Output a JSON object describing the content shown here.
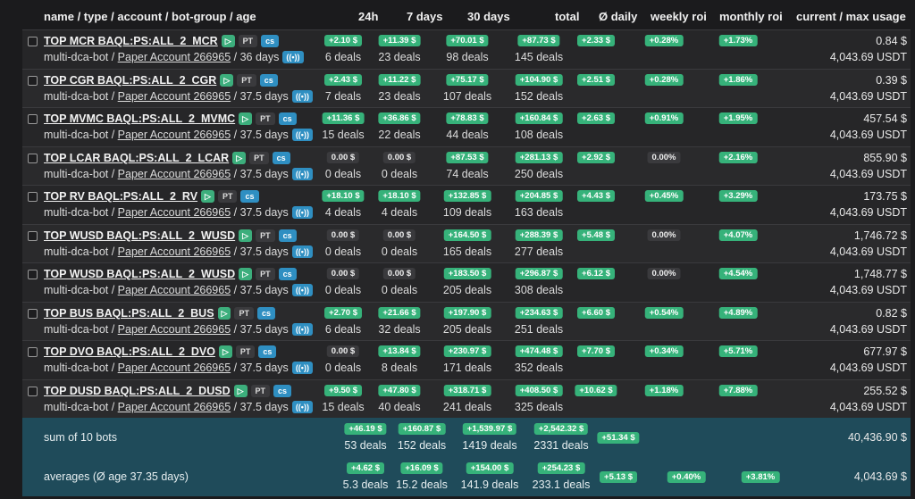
{
  "header": {
    "name_col": "name / type / account / bot-group / age",
    "h24": "24h",
    "d7": "7 days",
    "d30": "30 days",
    "total": "total",
    "daily": "Ø daily",
    "weekly": "weekly roi",
    "monthly": "monthly roi",
    "usage": "current / max usage"
  },
  "tags": {
    "play": "▷",
    "pt": "PT",
    "cs": "cs",
    "wave": "((•))"
  },
  "colors": {
    "green": "#36b27a",
    "neutral": "#3a3a3d",
    "summary_bg": "#1f4b5a",
    "cs": "#2f8fc2"
  },
  "bots": [
    {
      "name": "TOP MCR BAQL:PS:ALL_2_MCR",
      "type": "multi-dca-bot",
      "account": "Paper Account 266965",
      "age": "36 days",
      "h24": "+2.10 $",
      "h24_deals": "6 deals",
      "d7": "+11.39 $",
      "d7_deals": "23 deals",
      "d30": "+70.01 $",
      "d30_deals": "98 deals",
      "total": "+87.73 $",
      "total_deals": "145 deals",
      "daily": "+2.33 $",
      "weekly": "+0.28%",
      "monthly": "+1.73%",
      "current": "0.84 $",
      "max": "4,043.69 USDT"
    },
    {
      "name": "TOP CGR BAQL:PS:ALL_2_CGR",
      "type": "multi-dca-bot",
      "account": "Paper Account 266965",
      "age": "37.5 days",
      "h24": "+2.43 $",
      "h24_deals": "7 deals",
      "d7": "+11.22 $",
      "d7_deals": "23 deals",
      "d30": "+75.17 $",
      "d30_deals": "107 deals",
      "total": "+104.90 $",
      "total_deals": "152 deals",
      "daily": "+2.51 $",
      "weekly": "+0.28%",
      "monthly": "+1.86%",
      "current": "0.39 $",
      "max": "4,043.69 USDT"
    },
    {
      "name": "TOP MVMC BAQL:PS:ALL_2_MVMC",
      "type": "multi-dca-bot",
      "account": "Paper Account 266965",
      "age": "37.5 days",
      "h24": "+11.36 $",
      "h24_deals": "15 deals",
      "d7": "+36.86 $",
      "d7_deals": "22 deals",
      "d30": "+78.83 $",
      "d30_deals": "44 deals",
      "total": "+160.84 $",
      "total_deals": "108 deals",
      "daily": "+2.63 $",
      "weekly": "+0.91%",
      "monthly": "+1.95%",
      "current": "457.54 $",
      "max": "4,043.69 USDT"
    },
    {
      "name": "TOP LCAR BAQL:PS:ALL_2_LCAR",
      "type": "multi-dca-bot",
      "account": "Paper Account 266965",
      "age": "37.5 days",
      "h24": "0.00 $",
      "h24_deals": "0 deals",
      "d7": "0.00 $",
      "d7_deals": "0 deals",
      "d30": "+87.53 $",
      "d30_deals": "74 deals",
      "total": "+281.13 $",
      "total_deals": "250 deals",
      "daily": "+2.92 $",
      "weekly": "0.00%",
      "monthly": "+2.16%",
      "current": "855.90 $",
      "max": "4,043.69 USDT"
    },
    {
      "name": "TOP RV BAQL:PS:ALL_2_RV",
      "type": "multi-dca-bot",
      "account": "Paper Account 266965",
      "age": "37.5 days",
      "h24": "+18.10 $",
      "h24_deals": "4 deals",
      "d7": "+18.10 $",
      "d7_deals": "4 deals",
      "d30": "+132.85 $",
      "d30_deals": "109 deals",
      "total": "+204.85 $",
      "total_deals": "163 deals",
      "daily": "+4.43 $",
      "weekly": "+0.45%",
      "monthly": "+3.29%",
      "current": "173.75 $",
      "max": "4,043.69 USDT"
    },
    {
      "name": "TOP WUSD BAQL:PS:ALL_2_WUSD",
      "type": "multi-dca-bot",
      "account": "Paper Account 266965",
      "age": "37.5 days",
      "h24": "0.00 $",
      "h24_deals": "0 deals",
      "d7": "0.00 $",
      "d7_deals": "0 deals",
      "d30": "+164.50 $",
      "d30_deals": "165 deals",
      "total": "+288.39 $",
      "total_deals": "277 deals",
      "daily": "+5.48 $",
      "weekly": "0.00%",
      "monthly": "+4.07%",
      "current": "1,746.72 $",
      "max": "4,043.69 USDT"
    },
    {
      "name": "TOP WUSD BAQL:PS:ALL_2_WUSD",
      "type": "multi-dca-bot",
      "account": "Paper Account 266965",
      "age": "37.5 days",
      "h24": "0.00 $",
      "h24_deals": "0 deals",
      "d7": "0.00 $",
      "d7_deals": "0 deals",
      "d30": "+183.50 $",
      "d30_deals": "205 deals",
      "total": "+296.87 $",
      "total_deals": "308 deals",
      "daily": "+6.12 $",
      "weekly": "0.00%",
      "monthly": "+4.54%",
      "current": "1,748.77 $",
      "max": "4,043.69 USDT"
    },
    {
      "name": "TOP BUS BAQL:PS:ALL_2_BUS",
      "type": "multi-dca-bot",
      "account": "Paper Account 266965",
      "age": "37.5 days",
      "h24": "+2.70 $",
      "h24_deals": "6 deals",
      "d7": "+21.66 $",
      "d7_deals": "32 deals",
      "d30": "+197.90 $",
      "d30_deals": "205 deals",
      "total": "+234.63 $",
      "total_deals": "251 deals",
      "daily": "+6.60 $",
      "weekly": "+0.54%",
      "monthly": "+4.89%",
      "current": "0.82 $",
      "max": "4,043.69 USDT"
    },
    {
      "name": "TOP DVO BAQL:PS:ALL_2_DVO",
      "type": "multi-dca-bot",
      "account": "Paper Account 266965",
      "age": "37.5 days",
      "h24": "0.00 $",
      "h24_deals": "0 deals",
      "d7": "+13.84 $",
      "d7_deals": "8 deals",
      "d30": "+230.97 $",
      "d30_deals": "171 deals",
      "total": "+474.48 $",
      "total_deals": "352 deals",
      "daily": "+7.70 $",
      "weekly": "+0.34%",
      "monthly": "+5.71%",
      "current": "677.97 $",
      "max": "4,043.69 USDT"
    },
    {
      "name": "TOP DUSD BAQL:PS:ALL_2_DUSD",
      "type": "multi-dca-bot",
      "account": "Paper Account 266965",
      "age": "37.5 days",
      "h24": "+9.50 $",
      "h24_deals": "15 deals",
      "d7": "+47.80 $",
      "d7_deals": "40 deals",
      "d30": "+318.71 $",
      "d30_deals": "241 deals",
      "total": "+408.50 $",
      "total_deals": "325 deals",
      "daily": "+10.62 $",
      "weekly": "+1.18%",
      "monthly": "+7.88%",
      "current": "255.52 $",
      "max": "4,043.69 USDT"
    }
  ],
  "sum": {
    "label": "sum of 10 bots",
    "h24": "+46.19 $",
    "h24_deals": "53 deals",
    "d7": "+160.87 $",
    "d7_deals": "152 deals",
    "d30": "+1,539.97 $",
    "d30_deals": "1419 deals",
    "total": "+2,542.32 $",
    "total_deals": "2331 deals",
    "daily": "+51.34 $",
    "usage": "40,436.90 $"
  },
  "avg": {
    "label": "averages (Ø age 37.35 days)",
    "h24": "+4.62 $",
    "h24_deals": "5.3 deals",
    "d7": "+16.09 $",
    "d7_deals": "15.2 deals",
    "d30": "+154.00 $",
    "d30_deals": "141.9 deals",
    "total": "+254.23 $",
    "total_deals": "233.1 deals",
    "daily": "+5.13 $",
    "weekly": "+0.40%",
    "monthly": "+3.81%",
    "usage": "4,043.69 $"
  }
}
